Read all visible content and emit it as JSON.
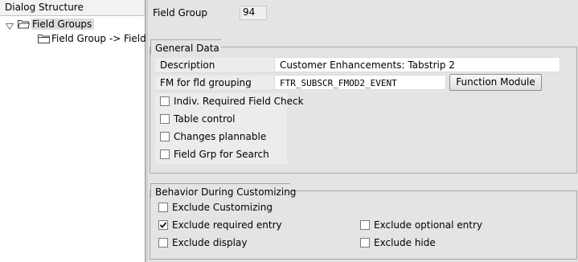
{
  "dialog_structure": {
    "title": "Dialog Structure",
    "tree": [
      {
        "label": "Field Groups",
        "expanded": true,
        "selected": true,
        "icon": "folder-open-icon"
      },
      {
        "label": "Field Group -> Fields",
        "expanded": false,
        "selected": false,
        "icon": "folder-icon"
      }
    ]
  },
  "header": {
    "field_group_label": "Field Group",
    "field_group_value": "94"
  },
  "general_data": {
    "title": "General Data",
    "description_label": "Description",
    "description_value": "Customer Enhancements: Tabstrip 2",
    "fm_label": "FM for fld grouping",
    "fm_value": "FTR_SUBSCR_FMOD2_EVENT",
    "function_module_button": "Function Module",
    "checkboxes": [
      {
        "label": "Indiv. Required Field Check",
        "checked": false
      },
      {
        "label": "Table control",
        "checked": false
      },
      {
        "label": "Changes plannable",
        "checked": false
      },
      {
        "label": "Field Grp for Search",
        "checked": false
      }
    ]
  },
  "behavior": {
    "title": "Behavior During Customizing",
    "checkboxes": {
      "exclude_customizing": {
        "label": "Exclude Customizing",
        "checked": false
      },
      "exclude_required_entry": {
        "label": "Exclude required entry",
        "checked": true
      },
      "exclude_optional_entry": {
        "label": "Exclude optional entry",
        "checked": false
      },
      "exclude_display": {
        "label": "Exclude display",
        "checked": false
      },
      "exclude_hide": {
        "label": "Exclude hide",
        "checked": false
      }
    }
  }
}
